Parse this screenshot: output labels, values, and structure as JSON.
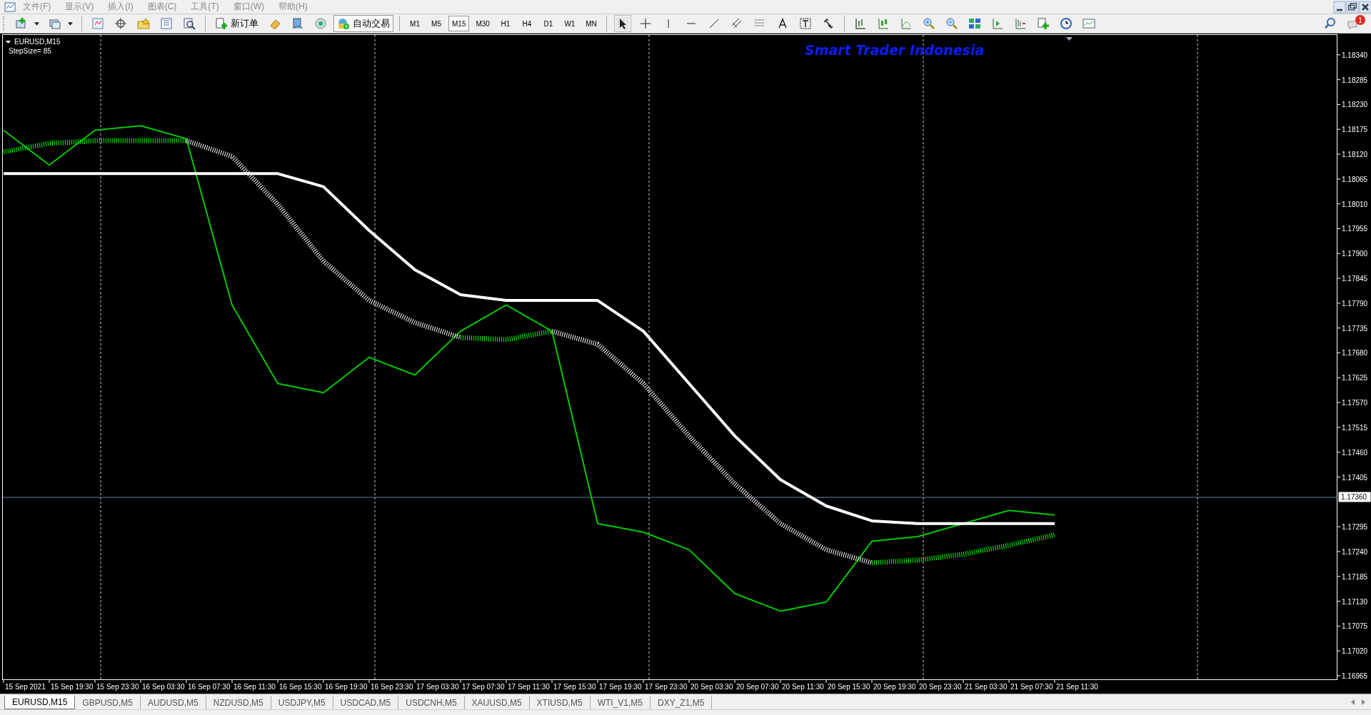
{
  "menu": [
    "文件(F)",
    "显示(V)",
    "插入(I)",
    "图表(C)",
    "工具(T)",
    "窗口(W)",
    "帮助(H)"
  ],
  "toolbar": {
    "new_order": "新订单",
    "auto_trading": {
      "label": "自动交易",
      "on": true
    },
    "timeframes": [
      {
        "label": "M1",
        "selected": false
      },
      {
        "label": "M5",
        "selected": false
      },
      {
        "label": "M15",
        "selected": true
      },
      {
        "label": "M30",
        "selected": false
      },
      {
        "label": "H1",
        "selected": false
      },
      {
        "label": "H4",
        "selected": false
      },
      {
        "label": "D1",
        "selected": false
      },
      {
        "label": "W1",
        "selected": false
      },
      {
        "label": "MN",
        "selected": false
      }
    ],
    "notifications": "1"
  },
  "chart": {
    "symbol": "EURUSD,M15",
    "indicator": "StepSize= 85",
    "overlay_text": "Smart Trader Indonesia",
    "chart_data": {
      "type": "line",
      "categories": [
        "15 Sep 2021",
        "15 Sep 19:30",
        "15 Sep 23:30",
        "16 Sep 03:30",
        "16 Sep 07:30",
        "16 Sep 11:30",
        "16 Sep 15:30",
        "16 Sep 19:30",
        "16 Sep 23:30",
        "17 Sep 03:30",
        "17 Sep 07:30",
        "17 Sep 11:30",
        "17 Sep 15:30",
        "17 Sep 19:30",
        "17 Sep 23:30",
        "20 Sep 03:30",
        "20 Sep 07:30",
        "20 Sep 11:30",
        "20 Sep 15:30",
        "20 Sep 19:30",
        "20 Sep 23:30",
        "21 Sep 03:30",
        "21 Sep 07:30",
        "21 Sep 11:30"
      ],
      "ylim": [
        1.16957,
        1.18384
      ],
      "series": [
        {
          "color": "#00c800",
          "values": [
            1.18173,
            1.18096,
            1.18173,
            1.18183,
            1.18154,
            1.17786,
            1.17612,
            1.17592,
            1.1767,
            1.17631,
            1.17728,
            1.17786,
            1.17728,
            1.17302,
            1.17283,
            1.17244,
            1.17147,
            1.17108,
            1.17128,
            1.17263,
            1.17273,
            1.17302,
            1.17331,
            1.17321
          ]
        },
        {
          "color": "#00ff00",
          "line_style": "dashed",
          "values": [
            1.18125,
            1.18144,
            1.1815,
            1.1815,
            1.1815,
            null,
            null,
            null,
            null,
            null,
            1.17714,
            1.17709,
            1.17728,
            null,
            null,
            null,
            null,
            null,
            null,
            1.17215,
            1.17221,
            1.17234,
            1.17254,
            1.17277
          ]
        },
        {
          "color": "#ffffff",
          "line_style": "dashed",
          "values": [
            null,
            null,
            null,
            null,
            1.1815,
            1.18115,
            1.18009,
            1.17883,
            1.17796,
            1.17747,
            1.17714,
            null,
            1.17728,
            1.17699,
            1.17612,
            1.17496,
            1.1739,
            1.17302,
            1.17244,
            1.17215,
            null,
            null,
            null,
            null
          ]
        },
        {
          "color": "#ffffff",
          "values": [
            1.18077,
            1.18077,
            1.18077,
            1.18077,
            1.18077,
            1.18077,
            1.18077,
            1.18048,
            1.17951,
            1.17864,
            1.17809,
            1.17796,
            1.17796,
            1.17796,
            1.17728,
            1.17612,
            1.17496,
            1.17399,
            1.17341,
            1.17308,
            1.17302,
            1.17302,
            1.17302,
            1.17302
          ]
        }
      ],
      "yticks": [
        {
          "value": 1.1834,
          "label": "1.18340"
        },
        {
          "value": 1.18285,
          "label": "1.18285"
        },
        {
          "value": 1.1823,
          "label": "1.18230"
        },
        {
          "value": 1.18175,
          "label": "1.18175"
        },
        {
          "value": 1.1812,
          "label": "1.18120"
        },
        {
          "value": 1.18065,
          "label": "1.18065"
        },
        {
          "value": 1.1801,
          "label": "1.18010"
        },
        {
          "value": 1.17955,
          "label": "1.17955"
        },
        {
          "value": 1.179,
          "label": "1.17900"
        },
        {
          "value": 1.17845,
          "label": "1.17845"
        },
        {
          "value": 1.1779,
          "label": "1.17790"
        },
        {
          "value": 1.17735,
          "label": "1.17735"
        },
        {
          "value": 1.1768,
          "label": "1.17680"
        },
        {
          "value": 1.17625,
          "label": "1.17625"
        },
        {
          "value": 1.1757,
          "label": "1.17570"
        },
        {
          "value": 1.17515,
          "label": "1.17515"
        },
        {
          "value": 1.1746,
          "label": "1.17460"
        },
        {
          "value": 1.17405,
          "label": "1.17405"
        },
        {
          "value": 1.17295,
          "label": "1.17295"
        },
        {
          "value": 1.1724,
          "label": "1.17240"
        },
        {
          "value": 1.17185,
          "label": "1.17185"
        },
        {
          "value": 1.1713,
          "label": "1.17130"
        },
        {
          "value": 1.17075,
          "label": "1.17075"
        },
        {
          "value": 1.1702,
          "label": "1.17020"
        },
        {
          "value": 1.16965,
          "label": "1.16965"
        }
      ],
      "ref_lines": [
        {
          "axis": "y",
          "value": 1.1736,
          "label": "1.17360"
        }
      ]
    }
  },
  "tabs": [
    {
      "label": "EURUSD,M15",
      "selected": true
    },
    {
      "label": "GBPUSD,M5",
      "selected": false
    },
    {
      "label": "AUDUSD,M5",
      "selected": false
    },
    {
      "label": "NZDUSD,M5",
      "selected": false
    },
    {
      "label": "USDJPY,M5",
      "selected": false
    },
    {
      "label": "USDCAD,M5",
      "selected": false
    },
    {
      "label": "USDCNH,M5",
      "selected": false
    },
    {
      "label": "XAUUSD,M5",
      "selected": false
    },
    {
      "label": "XTIUSD,M5",
      "selected": false
    },
    {
      "label": "WTI_V1,M5",
      "selected": false
    },
    {
      "label": "DXY_Z1,M5",
      "selected": false
    }
  ]
}
